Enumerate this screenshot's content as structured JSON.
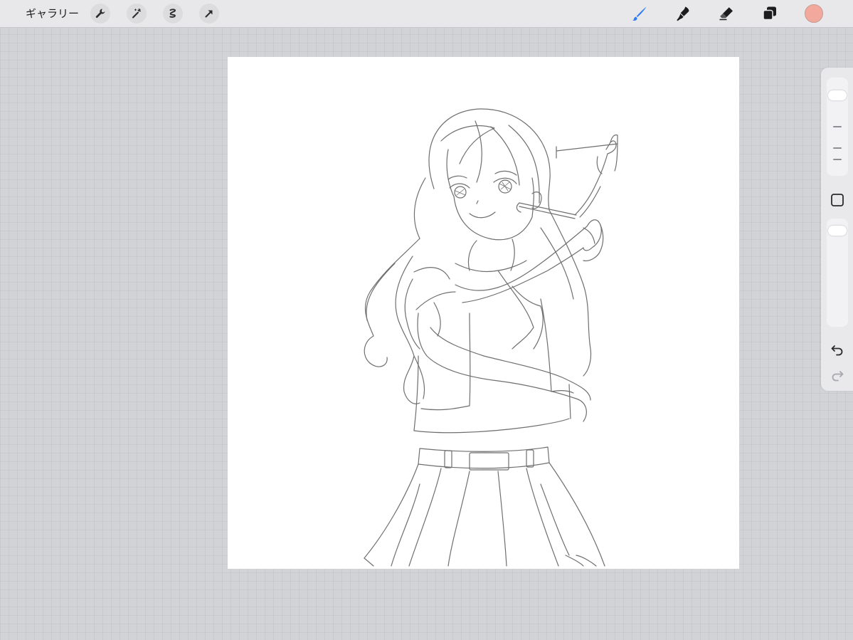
{
  "toolbar": {
    "gallery_label": "ギャラリー",
    "left_tools": [
      {
        "name": "wrench-icon"
      },
      {
        "name": "magic-wand-icon"
      },
      {
        "name": "selection-icon"
      },
      {
        "name": "transform-arrow-icon"
      }
    ],
    "right_tools": [
      {
        "name": "brush-icon",
        "active": true
      },
      {
        "name": "smudge-icon",
        "active": false
      },
      {
        "name": "eraser-icon",
        "active": false
      },
      {
        "name": "layers-icon",
        "active": false
      }
    ],
    "current_color": "#f2a89d",
    "active_color": "#2f7cf6"
  },
  "canvas": {
    "background": "#ffffff",
    "content": "line-art-drawing"
  },
  "sidebar": {
    "brush_size_slider": {
      "name": "brush-size-slider"
    },
    "opacity_slider": {
      "name": "brush-opacity-slider"
    },
    "modify_button": {
      "name": "square-modify-icon"
    },
    "undo": {
      "name": "undo-icon"
    },
    "redo": {
      "name": "redo-icon"
    }
  }
}
